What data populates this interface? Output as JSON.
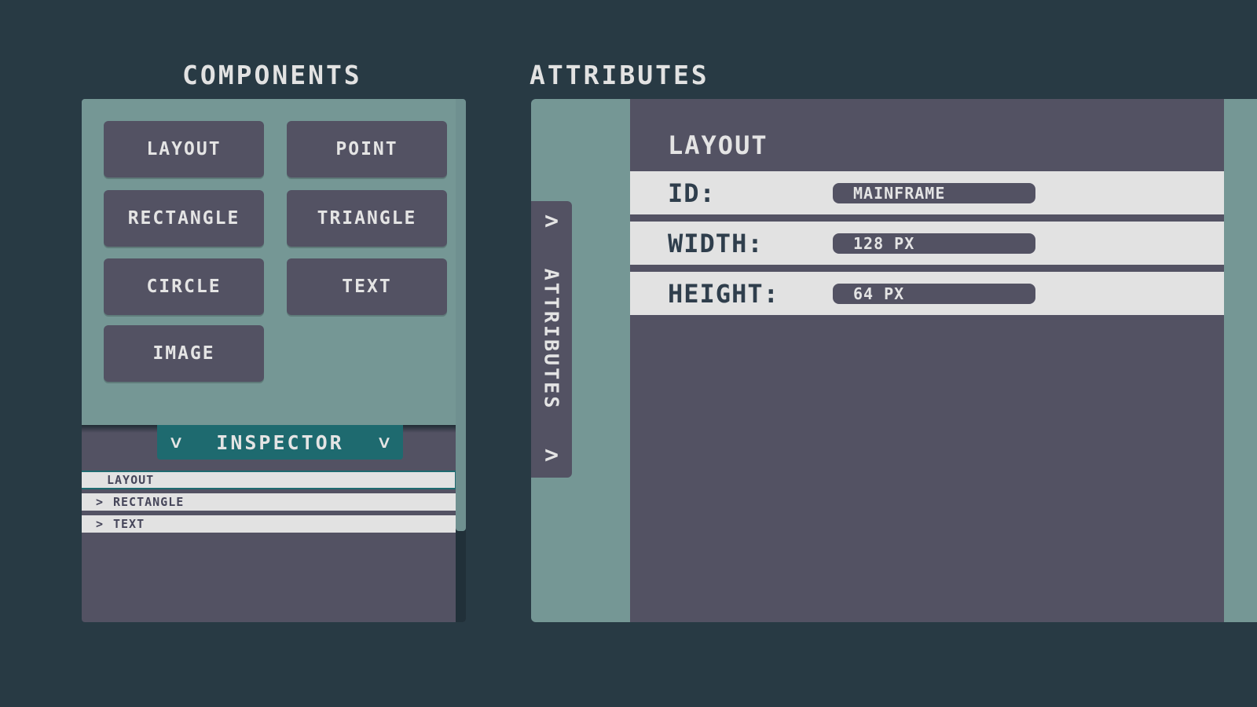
{
  "headings": {
    "components": "COMPONENTS",
    "attributes": "ATTRIBUTES"
  },
  "components": {
    "buttons": [
      "LAYOUT",
      "POINT",
      "RECTANGLE",
      "TRIANGLE",
      "CIRCLE",
      "TEXT",
      "IMAGE"
    ]
  },
  "inspector": {
    "label": "INSPECTOR",
    "left_icon": "chevron-down-icon",
    "right_icon": "chevron-down-icon",
    "tree": [
      {
        "label": "LAYOUT",
        "expandable": false,
        "selected": true
      },
      {
        "label": "RECTANGLE",
        "expandable": true,
        "selected": false
      },
      {
        "label": "TEXT",
        "expandable": true,
        "selected": false
      }
    ]
  },
  "attributes": {
    "side_tab_label": "ATTRIBUTES",
    "side_tab_icon": "chevron-right-icon",
    "title": "LAYOUT",
    "fields": [
      {
        "key": "ID:",
        "value": "MAINFRAME"
      },
      {
        "key": "WIDTH:",
        "value": "128 PX"
      },
      {
        "key": "HEIGHT:",
        "value": "64 PX"
      }
    ]
  },
  "colors": {
    "background": "#283a44",
    "panel_dark": "#535263",
    "panel_teal": "#759795",
    "accent": "#1e6a6f",
    "row_light": "#e2e2e2",
    "text_light": "#e4e4e4",
    "text_dark": "#2f3e4c"
  }
}
